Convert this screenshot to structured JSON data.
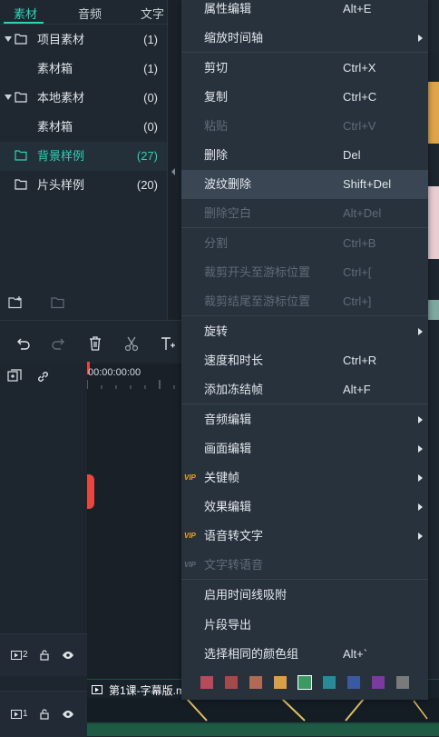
{
  "media_panel": {
    "tabs": [
      "素材",
      "音频",
      "文字"
    ],
    "tree": [
      {
        "label": "项目素材",
        "count": "(1)"
      },
      {
        "label": "素材箱",
        "count": "(1)"
      },
      {
        "label": "本地素材",
        "count": "(0)"
      },
      {
        "label": "素材箱",
        "count": "(0)"
      },
      {
        "label": "背景样例",
        "count": "(27)"
      },
      {
        "label": "片头样例",
        "count": "(20)"
      }
    ]
  },
  "timeline": {
    "timecode": "00:00:00:00",
    "track2_num": "2",
    "track1_num": "1",
    "clip_title": "第1课-字幕版.m"
  },
  "context_menu": {
    "items": [
      {
        "label": "属性编辑",
        "shortcut": "Alt+E"
      },
      {
        "label": "缩放时间轴",
        "shortcut": ""
      },
      {
        "label": "剪切",
        "shortcut": "Ctrl+X"
      },
      {
        "label": "复制",
        "shortcut": "Ctrl+C"
      },
      {
        "label": "粘贴",
        "shortcut": "Ctrl+V"
      },
      {
        "label": "删除",
        "shortcut": "Del"
      },
      {
        "label": "波纹删除",
        "shortcut": "Shift+Del"
      },
      {
        "label": "删除空白",
        "shortcut": "Alt+Del"
      },
      {
        "label": "分割",
        "shortcut": "Ctrl+B"
      },
      {
        "label": "裁剪开头至游标位置",
        "shortcut": "Ctrl+["
      },
      {
        "label": "裁剪结尾至游标位置",
        "shortcut": "Ctrl+]"
      },
      {
        "label": "旋转",
        "shortcut": ""
      },
      {
        "label": "速度和时长",
        "shortcut": "Ctrl+R"
      },
      {
        "label": "添加冻结帧",
        "shortcut": "Alt+F"
      },
      {
        "label": "音频编辑",
        "shortcut": ""
      },
      {
        "label": "画面编辑",
        "shortcut": ""
      },
      {
        "label": "关键帧",
        "shortcut": "",
        "badge": "VIP"
      },
      {
        "label": "效果编辑",
        "shortcut": ""
      },
      {
        "label": "语音转文字",
        "shortcut": "",
        "badge": "VIP"
      },
      {
        "label": "文字转语音",
        "shortcut": "",
        "badge": "VIP"
      },
      {
        "label": "启用时间线吸附",
        "shortcut": ""
      },
      {
        "label": "片段导出",
        "shortcut": ""
      },
      {
        "label": "选择相同的颜色组",
        "shortcut": "Alt+`"
      }
    ],
    "color_swatches": [
      "#b94a5a",
      "#a24a4c",
      "#b06a55",
      "#d9a04a",
      "#3a9a62",
      "#2a8a9a",
      "#3a5aa0",
      "#7a3aa0",
      "#7a7a7a"
    ]
  },
  "colors": {
    "accent": "#2fd2b5",
    "playhead": "#e8473f"
  }
}
